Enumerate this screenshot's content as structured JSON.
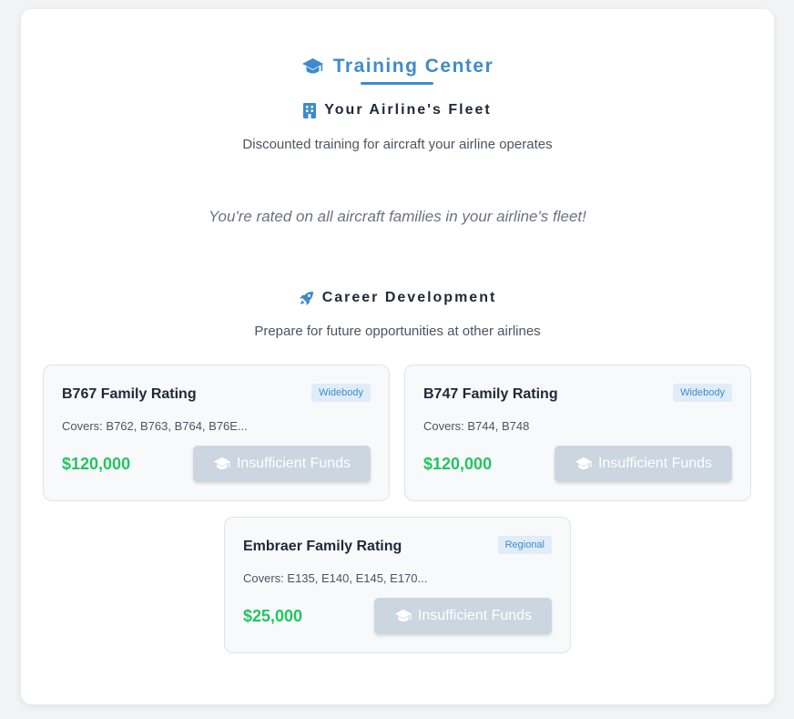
{
  "header": {
    "title": "Training Center",
    "icon": "graduation-cap-icon",
    "accent_color": "#3d8bcd"
  },
  "fleet_section": {
    "heading": "Your Airline's Fleet",
    "icon": "building-icon",
    "subtitle": "Discounted training for aircraft your airline operates",
    "note": "You're rated on all aircraft families in your airline's fleet!"
  },
  "career_section": {
    "heading": "Career Development",
    "icon": "rocket-icon",
    "subtitle": "Prepare for future opportunities at other airlines",
    "cards": [
      {
        "name": "B767 Family Rating",
        "badge": "Widebody",
        "covers": "Covers: B762, B763, B764, B76E...",
        "price": "$120,000",
        "button_label": "Insufficient Funds"
      },
      {
        "name": "B747 Family Rating",
        "badge": "Widebody",
        "covers": "Covers: B744, B748",
        "price": "$120,000",
        "button_label": "Insufficient Funds"
      },
      {
        "name": "Embraer Family Rating",
        "badge": "Regional",
        "covers": "Covers: E135, E140, E145, E170...",
        "price": "$25,000",
        "button_label": "Insufficient Funds"
      }
    ]
  },
  "colors": {
    "price": "#22c55e",
    "disabled_button": "#ccd6e0",
    "badge_bg": "#e0edf8"
  }
}
